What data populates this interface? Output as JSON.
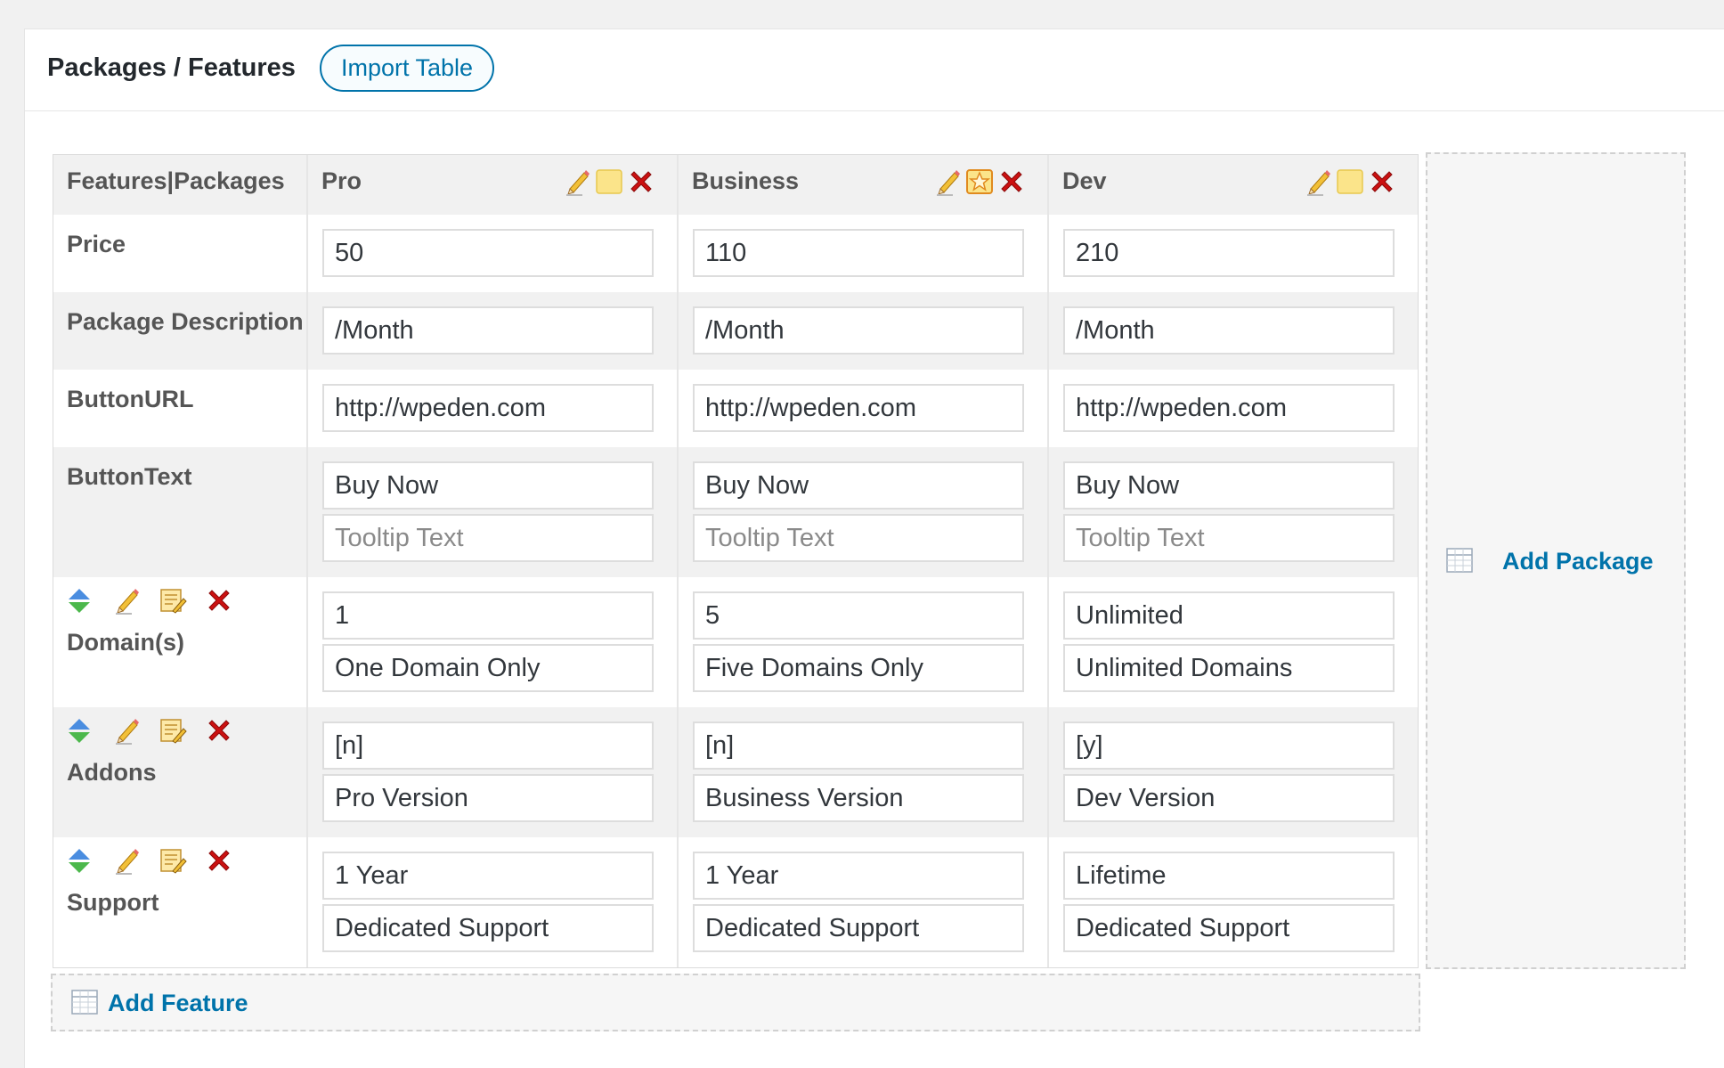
{
  "header": {
    "title": "Packages / Features",
    "import_button": "Import Table"
  },
  "table": {
    "corner_label": "Features|Packages",
    "packages": [
      {
        "name": "Pro",
        "featured": false
      },
      {
        "name": "Business",
        "featured": true
      },
      {
        "name": "Dev",
        "featured": false
      }
    ],
    "rows": {
      "price": {
        "label": "Price",
        "values": [
          "50",
          "110",
          "210"
        ]
      },
      "description": {
        "label": "Package Description",
        "values": [
          "/Month",
          "/Month",
          "/Month"
        ]
      },
      "button_url": {
        "label": "ButtonURL",
        "values": [
          "http://wpeden.com",
          "http://wpeden.com",
          "http://wpeden.com"
        ]
      },
      "button_text": {
        "label": "ButtonText",
        "values": [
          "Buy Now",
          "Buy Now",
          "Buy Now"
        ],
        "tooltip_placeholder": "Tooltip Text"
      }
    },
    "features": [
      {
        "label": "Domain(s)",
        "values": [
          "1",
          "5",
          "Unlimited"
        ],
        "descriptions": [
          "One Domain Only",
          "Five Domains Only",
          "Unlimited Domains"
        ]
      },
      {
        "label": "Addons",
        "values": [
          "[n]",
          "[n]",
          "[y]"
        ],
        "descriptions": [
          "Pro Version",
          "Business Version",
          "Dev Version"
        ]
      },
      {
        "label": "Support",
        "values": [
          "1 Year",
          "1 Year",
          "Lifetime"
        ],
        "descriptions": [
          "Dedicated Support",
          "Dedicated Support",
          "Dedicated Support"
        ]
      }
    ]
  },
  "add_package_label": "Add Package",
  "add_feature_label": "Add Feature",
  "icons": {
    "edit": "pencil-icon",
    "featured_off": "highlight-box-icon",
    "featured_on": "star-icon",
    "delete": "close-icon",
    "move": "move-arrows-icon",
    "note": "note-edit-icon",
    "grid": "table-grid-icon"
  },
  "colors": {
    "accent": "#0073aa",
    "delete": "#cc1111",
    "row_shade": "#f1f1f1"
  }
}
